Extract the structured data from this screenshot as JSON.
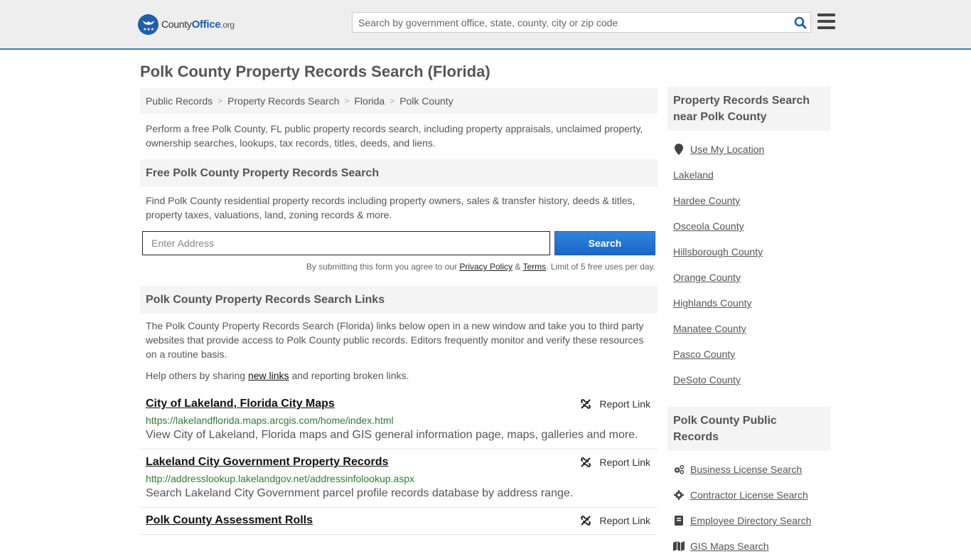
{
  "header": {
    "logo": {
      "name": "County",
      "bold": "Office",
      "suffix": ".org"
    },
    "search_placeholder": "Search by government office, state, county, city or zip code"
  },
  "page_title": "Polk County Property Records Search (Florida)",
  "breadcrumb": [
    "Public Records",
    "Property Records Search",
    "Florida",
    "Polk County"
  ],
  "intro": "Perform a free Polk County, FL public property records search, including property appraisals, unclaimed property, ownership searches, lookups, tax records, titles, deeds, and liens.",
  "free_search": {
    "heading": "Free Polk County Property Records Search",
    "description": "Find Polk County residential property records including property owners, sales & transfer history, deeds & titles, property taxes, valuations, land, zoning records & more.",
    "input_placeholder": "Enter Address",
    "button_label": "Search",
    "disclaimer_prefix": "By submitting this form you agree to our ",
    "privacy_label": "Privacy Policy",
    "amp": " & ",
    "terms_label": "Terms",
    "disclaimer_suffix": ". Limit of 5 free uses per day."
  },
  "links_section": {
    "heading": "Polk County Property Records Search Links",
    "description": "The Polk County Property Records Search (Florida) links below open in a new window and take you to third party websites that provide access to Polk County public records. Editors frequently monitor and verify these resources on a routine basis.",
    "help_prefix": "Help others by sharing ",
    "help_link": "new links",
    "help_suffix": " and reporting broken links.",
    "report_label": "Report Link",
    "items": [
      {
        "title": "City of Lakeland, Florida City Maps",
        "url": "https://lakelandflorida.maps.arcgis.com/home/index.html",
        "description": "View City of Lakeland, Florida maps and GIS general information page, maps, galleries and more."
      },
      {
        "title": "Lakeland City Government Property Records",
        "url": "http://addresslookup.lakelandgov.net/addressinfolookup.aspx",
        "description": "Search Lakeland City Government parcel profile records database by address range."
      },
      {
        "title": "Polk County Assessment Rolls",
        "url": "",
        "description": ""
      }
    ]
  },
  "sidebar": {
    "nearby": {
      "heading": "Property Records Search near Polk County",
      "location_label": "Use My Location",
      "items": [
        "Lakeland",
        "Hardee County",
        "Osceola County",
        "Hillsborough County",
        "Orange County",
        "Highlands County",
        "Manatee County",
        "Pasco County",
        "DeSoto County"
      ]
    },
    "public_records": {
      "heading": "Polk County Public Records",
      "items": [
        {
          "label": "Business License Search",
          "icon": "gears-icon"
        },
        {
          "label": "Contractor License Search",
          "icon": "gear-icon"
        },
        {
          "label": "Employee Directory Search",
          "icon": "book-icon"
        },
        {
          "label": "GIS Maps Search",
          "icon": "map-icon"
        }
      ]
    }
  }
}
